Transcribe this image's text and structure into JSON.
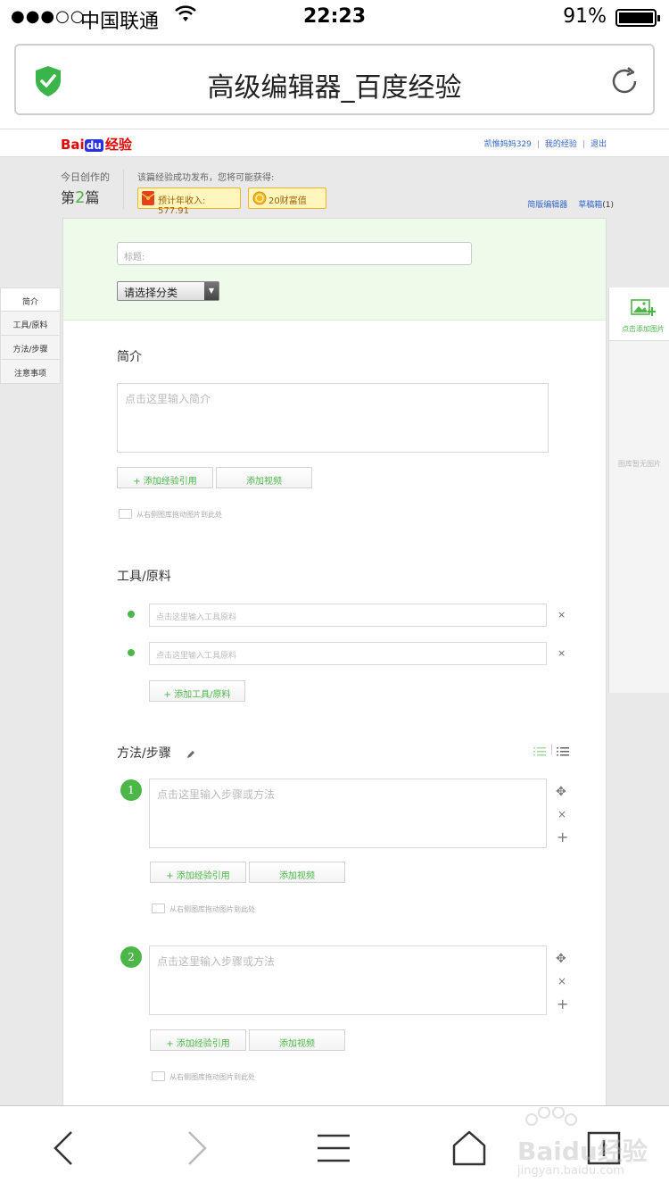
{
  "status_bar": {
    "signal": "●●●○○",
    "carrier": "中国联通",
    "time": "22:23",
    "battery": "91%",
    "battery_level": 0.91
  },
  "browser": {
    "title": "高级编辑器_百度经验"
  },
  "site_header": {
    "logo_bai": "Bai",
    "logo_du": "du",
    "logo_jingyan": "经验",
    "username": "凯惟妈妈329",
    "my_experience": "我的经验",
    "logout": "退出"
  },
  "stats": {
    "today_label": "今日创作的",
    "count_prefix": "第",
    "count": "2",
    "count_suffix": "篇",
    "publish_note": "该篇经验成功发布，您将可能获得:",
    "income": "预计年收入: 577.91",
    "wealth": "20财富值",
    "simple_editor": "简版编辑器",
    "drafts": "草稿箱",
    "drafts_count": "(1)"
  },
  "left_nav": {
    "items": [
      "简介",
      "工具/原料",
      "方法/步骤",
      "注意事项"
    ]
  },
  "editor": {
    "title_placeholder": "标题:",
    "category": "请选择分类",
    "intro": {
      "heading": "简介",
      "placeholder": "点击这里输入简介",
      "add_reference": "+ 添加经验引用",
      "add_video": "添加视频",
      "drag_hint": "从右侧图库拖动图片到此处"
    },
    "tools": {
      "heading": "工具/原料",
      "placeholder": "点击这里输入工具原料",
      "add_tool": "+ 添加工具/原料",
      "remove": "×"
    },
    "steps": {
      "heading": "方法/步骤",
      "placeholder": "点击这里输入步骤或方法",
      "add_reference": "+ 添加经验引用",
      "add_video": "添加视频",
      "drag_hint": "从右侧图库拖动图片到此处",
      "step_numbers": [
        "1",
        "2"
      ],
      "move": "✥",
      "remove": "×",
      "add": "+"
    }
  },
  "right_panel": {
    "add_image": "点击添加图片",
    "empty": "图库暂无图片"
  },
  "watermark": {
    "brand": "Baidu经验",
    "url": "jingyan.baidu.com"
  },
  "colors": {
    "accent_green": "#4cb648",
    "link_blue": "#3366cc",
    "logo_red": "#e10602"
  }
}
